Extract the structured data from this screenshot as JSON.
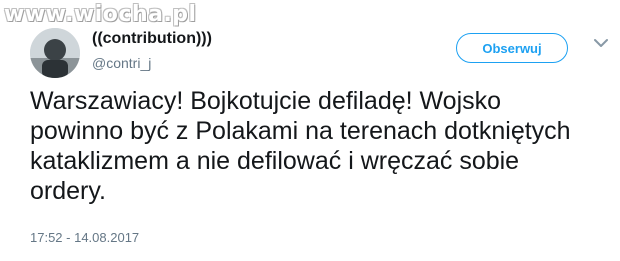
{
  "watermark": {
    "text": "www.wiocha.pl"
  },
  "author": {
    "display_name": "((contribution)))",
    "handle": "@contri_j"
  },
  "actions": {
    "follow_label": "Obserwuj",
    "menu_icon": "chevron-down-icon"
  },
  "tweet": {
    "text": "Warszawiacy! Bojkotujcie defiladę! Wojsko powinno być z Polakami na terenach dotkniętych kataklizmem a nie defilować i wręczać sobie ordery.",
    "timestamp": "17:52 - 14.08.2017"
  },
  "colors": {
    "accent": "#1da1f2",
    "text": "#14171a",
    "muted": "#657786"
  }
}
